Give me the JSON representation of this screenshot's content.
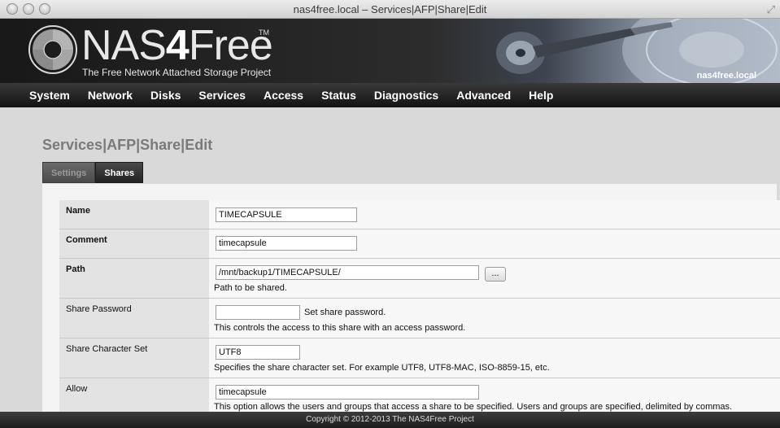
{
  "window": {
    "title": "nas4free.local – Services|AFP|Share|Edit"
  },
  "header": {
    "logo_nas": "NAS",
    "logo_four": "4",
    "logo_free": "Free",
    "logo_tm": "TM",
    "tagline": "The Free Network Attached Storage Project",
    "hostname": "nas4free.local"
  },
  "nav": {
    "items": [
      "System",
      "Network",
      "Disks",
      "Services",
      "Access",
      "Status",
      "Diagnostics",
      "Advanced",
      "Help"
    ]
  },
  "page": {
    "title": "Services|AFP|Share|Edit",
    "tabs": [
      {
        "label": "Settings",
        "active": false
      },
      {
        "label": "Shares",
        "active": true
      }
    ]
  },
  "form": {
    "name": {
      "label": "Name",
      "value": "TIMECAPSULE"
    },
    "comment": {
      "label": "Comment",
      "value": "timecapsule"
    },
    "path": {
      "label": "Path",
      "value": "/mnt/backup1/TIMECAPSULE/",
      "browse": "...",
      "desc": "Path to be shared."
    },
    "password": {
      "label": "Share Password",
      "value": "",
      "inline": "Set share password.",
      "desc": "This controls the access to this share with an access password."
    },
    "charset": {
      "label": "Share Character Set",
      "value": "UTF8",
      "desc": "Specifies the share character set. For example UTF8, UTF8-MAC, ISO-8859-15, etc."
    },
    "allow": {
      "label": "Allow",
      "value": "timecapsule",
      "desc": "This option allows the users and groups that access a share to be specified. Users and groups are specified, delimited by commas."
    }
  },
  "footer": {
    "copyright": "Copyright © 2012-2013 The NAS4Free Project"
  }
}
